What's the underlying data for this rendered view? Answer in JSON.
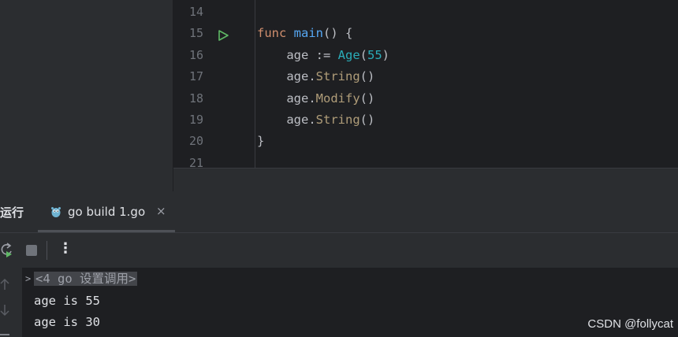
{
  "editor": {
    "lines": [
      {
        "no": "14",
        "parts": []
      },
      {
        "no": "15",
        "runnable": true,
        "parts": [
          {
            "t": "func",
            "c": "kw"
          },
          {
            "t": " ",
            "c": "plain"
          },
          {
            "t": "main",
            "c": "fn"
          },
          {
            "t": "() {",
            "c": "plain"
          }
        ]
      },
      {
        "no": "16",
        "parts": [
          {
            "t": "    age := ",
            "c": "plain"
          },
          {
            "t": "Age",
            "c": "ty"
          },
          {
            "t": "(",
            "c": "plain"
          },
          {
            "t": "55",
            "c": "num"
          },
          {
            "t": ")",
            "c": "plain"
          }
        ]
      },
      {
        "no": "17",
        "parts": [
          {
            "t": "    age.",
            "c": "plain"
          },
          {
            "t": "String",
            "c": "mt"
          },
          {
            "t": "()",
            "c": "plain"
          }
        ]
      },
      {
        "no": "18",
        "parts": [
          {
            "t": "    age.",
            "c": "plain"
          },
          {
            "t": "Modify",
            "c": "mt"
          },
          {
            "t": "()",
            "c": "plain"
          }
        ]
      },
      {
        "no": "19",
        "parts": [
          {
            "t": "    age.",
            "c": "plain"
          },
          {
            "t": "String",
            "c": "mt"
          },
          {
            "t": "()",
            "c": "plain"
          }
        ]
      },
      {
        "no": "20",
        "parts": [
          {
            "t": "}",
            "c": "plain"
          }
        ]
      },
      {
        "no": "21",
        "parts": []
      }
    ]
  },
  "run_panel": {
    "title": "运行",
    "tab": {
      "label": "go build 1.go",
      "close": "×",
      "icon": "gopher-icon"
    },
    "toolbar": {
      "rerun_icon": "rerun-icon",
      "stop_icon": "stop-icon",
      "more": "⋮"
    },
    "console": {
      "fold_marker": ">",
      "folded_text": "<4 go 设置调用>",
      "lines": [
        "age is 55",
        "age is 30"
      ]
    }
  },
  "watermark": "CSDN @follycat",
  "colors": {
    "keyword": "#cf8e6d",
    "function": "#56a8f5",
    "type_number": "#2aacb8",
    "method": "#b09d79",
    "run_green": "#5fb865"
  }
}
